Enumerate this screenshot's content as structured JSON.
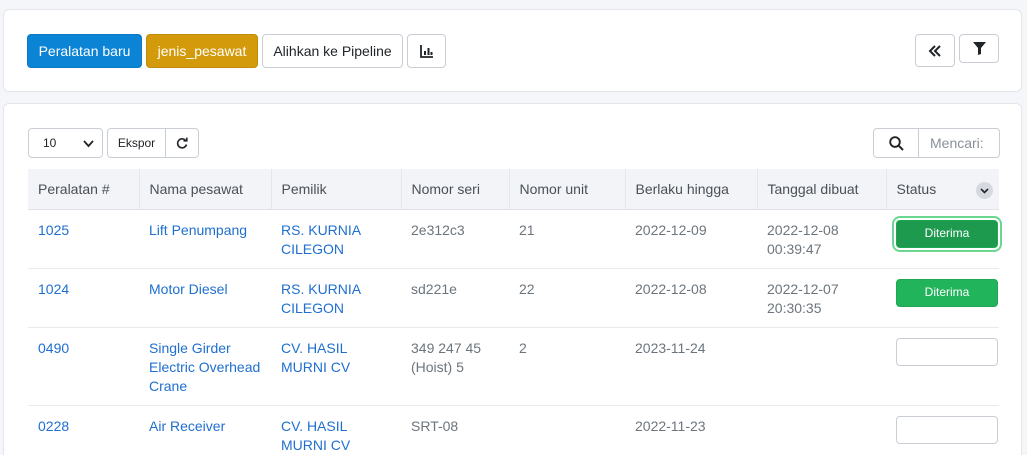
{
  "toolbar": {
    "new_equipment_label": "Peralatan baru",
    "aircraft_type_label": "jenis_pesawat",
    "pipeline_label": "Alihkan ke Pipeline"
  },
  "table_controls": {
    "page_size": "10",
    "export_label": "Ekspor",
    "search_placeholder": "Mencari:"
  },
  "table": {
    "columns": [
      "Peralatan #",
      "Nama pesawat",
      "Pemilik",
      "Nomor seri",
      "Nomor unit",
      "Berlaku hingga",
      "Tanggal dibuat",
      "Status"
    ],
    "rows": [
      {
        "id": "1025",
        "name": "Lift Penumpang",
        "owner": "RS. KURNIA CILEGON",
        "serial": "2e312c3",
        "unit": "21",
        "valid_until": "2022-12-09",
        "created": "2022-12-08 00:39:47",
        "status": "Diterima"
      },
      {
        "id": "1024",
        "name": "Motor Diesel",
        "owner": "RS. KURNIA CILEGON",
        "serial": "sd221e",
        "unit": "22",
        "valid_until": "2022-12-08",
        "created": "2022-12-07 20:30:35",
        "status": "Diterima"
      },
      {
        "id": "0490",
        "name": "Single Girder Electric Overhead Crane",
        "owner": "CV. HASIL MURNI CV",
        "serial": "349 247 45 (Hoist) 5",
        "unit": "2",
        "valid_until": "2023-11-24",
        "created": "",
        "status": ""
      },
      {
        "id": "0228",
        "name": "Air Receiver",
        "owner": "CV. HASIL MURNI CV",
        "serial": "SRT-08",
        "unit": "",
        "valid_until": "2022-11-23",
        "created": "",
        "status": ""
      }
    ]
  },
  "colors": {
    "primary": "#0b84d6",
    "warning": "#d39a0c",
    "success": "#22b45a",
    "link": "#1f6fd0"
  }
}
